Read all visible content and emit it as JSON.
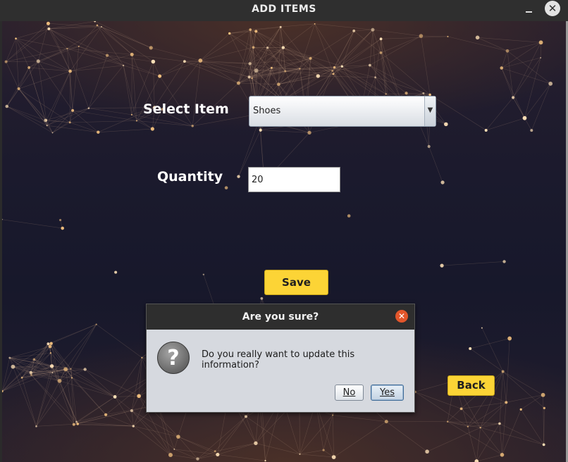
{
  "window": {
    "title": "ADD ITEMS",
    "minimize_glyph": "",
    "close_glyph": "✕"
  },
  "form": {
    "select_item_label": "Select Item",
    "select_item_value": "Shoes",
    "dropdown_arrow": "▼",
    "quantity_label": "Quantity",
    "quantity_value": "20",
    "save_label": "Save",
    "back_label": "Back"
  },
  "dialog": {
    "title": "Are you sure?",
    "close_glyph": "✕",
    "icon_glyph": "?",
    "message": "Do you really want to update this information?",
    "no_label": "No",
    "yes_label": "Yes"
  },
  "colors": {
    "button_yellow": "#fcd436",
    "dialog_close": "#e3562b",
    "titlebar": "#2f2f2f"
  }
}
